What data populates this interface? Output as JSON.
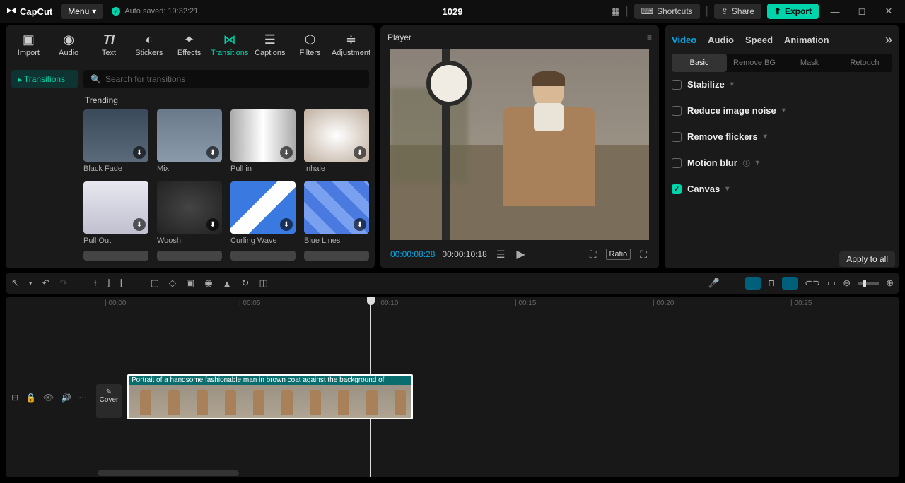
{
  "titlebar": {
    "app_name": "CapCut",
    "menu_label": "Menu",
    "autosave_label": "Auto saved: 19:32:21",
    "project_title": "1029",
    "shortcuts_label": "Shortcuts",
    "share_label": "Share",
    "export_label": "Export"
  },
  "tools": [
    {
      "label": "Import",
      "icon": "▣"
    },
    {
      "label": "Audio",
      "icon": "◉"
    },
    {
      "label": "Text",
      "icon": "TI"
    },
    {
      "label": "Stickers",
      "icon": "◐"
    },
    {
      "label": "Effects",
      "icon": "✦"
    },
    {
      "label": "Transitions",
      "icon": "⋈"
    },
    {
      "label": "Captions",
      "icon": "☰"
    },
    {
      "label": "Filters",
      "icon": "⬡"
    },
    {
      "label": "Adjustment",
      "icon": "⚙"
    }
  ],
  "active_tool": "Transitions",
  "sidebar_tab": "Transitions",
  "search_placeholder": "Search for transitions",
  "trending_label": "Trending",
  "transitions": [
    {
      "label": "Black Fade"
    },
    {
      "label": "Mix"
    },
    {
      "label": "Pull in"
    },
    {
      "label": "Inhale"
    },
    {
      "label": "Pull Out"
    },
    {
      "label": "Woosh"
    },
    {
      "label": "Curling Wave"
    },
    {
      "label": "Blue Lines"
    }
  ],
  "player": {
    "title": "Player",
    "time_current": "00:00:08:28",
    "time_duration": "00:00:10:18",
    "ratio_label": "Ratio"
  },
  "right": {
    "tabs": [
      "Video",
      "Audio",
      "Speed",
      "Animation"
    ],
    "active_tab": "Video",
    "subtabs": [
      "Basic",
      "Remove BG",
      "Mask",
      "Retouch"
    ],
    "active_subtab": "Basic",
    "opts": [
      {
        "label": "Stabilize",
        "checked": false
      },
      {
        "label": "Reduce image noise",
        "checked": false
      },
      {
        "label": "Remove flickers",
        "checked": false
      },
      {
        "label": "Motion blur",
        "checked": false,
        "info": true
      },
      {
        "label": "Canvas",
        "checked": true
      }
    ],
    "apply_all": "Apply to all"
  },
  "timeline": {
    "marks": [
      "00:00",
      "00:05",
      "00:10",
      "00:15",
      "00:20",
      "00:25"
    ],
    "cover_label": "Cover",
    "clip_title": "Portrait of a handsome fashionable man in brown coat against the background of"
  },
  "colors": {
    "accent": "#00d4aa",
    "blue": "#00a8e8"
  }
}
